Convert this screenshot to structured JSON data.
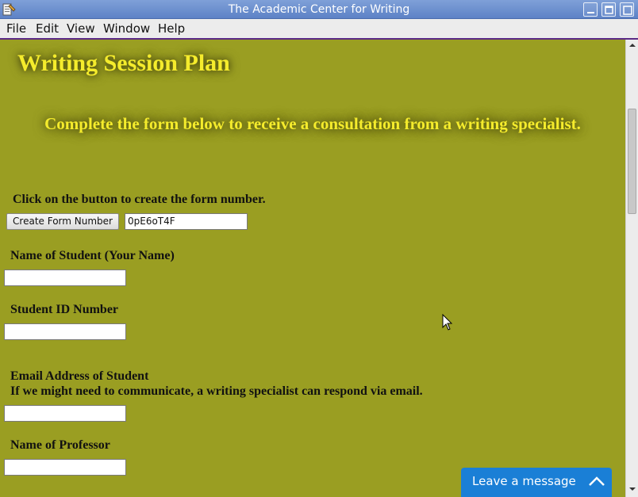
{
  "window": {
    "title": "The Academic Center for Writing"
  },
  "menu": {
    "items": [
      "File",
      "Edit",
      "View",
      "Window",
      "Help"
    ]
  },
  "page": {
    "heading": "Writing Session Plan",
    "subheading": "Complete the form below to receive a consultation from a writing specialist.",
    "form_number": {
      "instruction": "Click on the button to create the form number.",
      "button_label": "Create Form Number",
      "value": "0pE6oT4F"
    },
    "fields": [
      {
        "label": "Name of Student (Your Name)",
        "value": ""
      },
      {
        "label": "Student ID Number",
        "value": ""
      },
      {
        "label": "Email Address of Student",
        "sublabel": "If we might need to communicate, a writing specialist can respond via email.",
        "value": ""
      },
      {
        "label": "Name of Professor",
        "value": ""
      }
    ]
  },
  "chat_widget": {
    "label": "Leave a message",
    "icon": "chevron-up-icon"
  },
  "colors": {
    "page_background": "#9a9e22",
    "heading_text": "#f5ec2c",
    "titlebar": "#6b8fd0",
    "chat_widget": "#1a7fd6"
  }
}
